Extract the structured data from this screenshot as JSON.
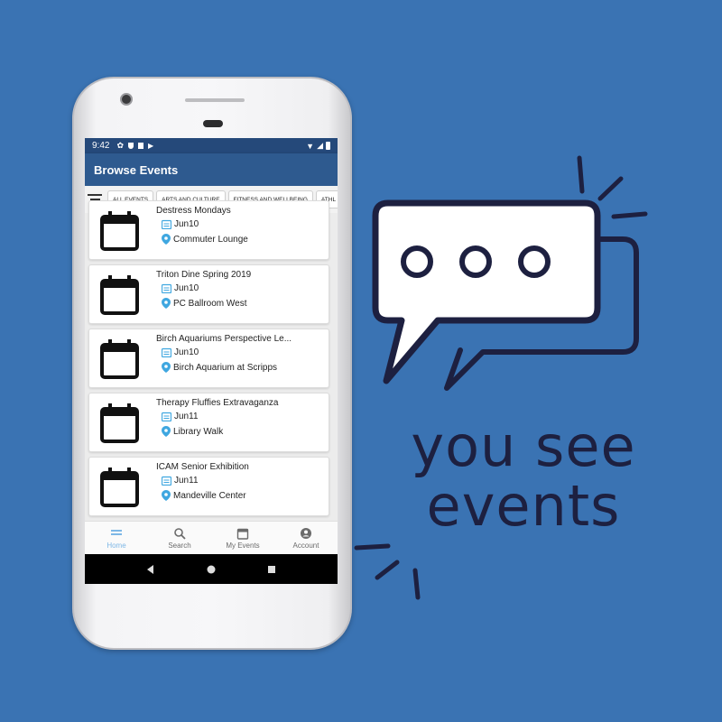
{
  "status_bar": {
    "time": "9:42"
  },
  "app_bar": {
    "title": "Browse Events"
  },
  "filters": [
    "ALL EVENTS",
    "ARTS AND CULTURE",
    "FITNESS AND WELLBEING",
    "ATHL"
  ],
  "events": [
    {
      "title": "Destress Mondays",
      "date": "Jun10",
      "location": "Commuter Lounge"
    },
    {
      "title": "Triton Dine Spring 2019",
      "date": "Jun10",
      "location": "PC Ballroom West"
    },
    {
      "title": "Birch Aquariums Perspective Le...",
      "date": "Jun10",
      "location": "Birch Aquarium at Scripps"
    },
    {
      "title": "Therapy Fluffies Extravaganza",
      "date": "Jun11",
      "location": "Library Walk"
    },
    {
      "title": "ICAM Senior Exhibition",
      "date": "Jun11",
      "location": "Mandeville Center"
    }
  ],
  "bottom_nav": [
    {
      "label": "Home",
      "icon": "home-icon",
      "active": true
    },
    {
      "label": "Search",
      "icon": "search-icon",
      "active": false
    },
    {
      "label": "My Events",
      "icon": "calendar-icon",
      "active": false
    },
    {
      "label": "Account",
      "icon": "account-icon",
      "active": false
    }
  ],
  "tagline": {
    "line1": "you see",
    "line2": "events"
  },
  "colors": {
    "background": "#3a73b3",
    "app_bar": "#2e5a8f",
    "accent": "#7db7e6",
    "pin": "#3fa7e0",
    "ink": "#1d2040"
  }
}
